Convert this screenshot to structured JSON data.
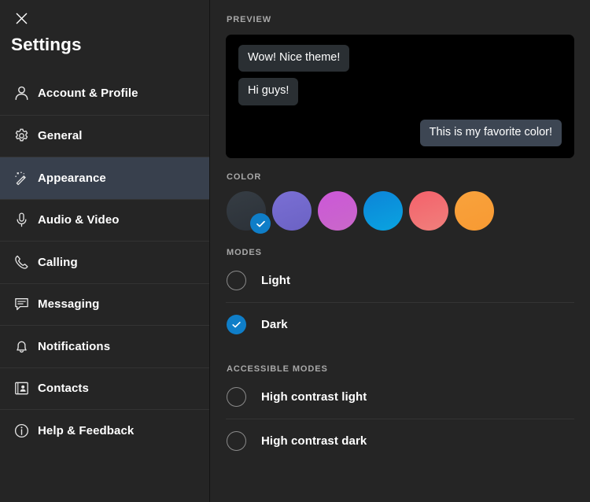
{
  "window": {
    "close_icon": "close-icon",
    "title": "Settings"
  },
  "sidebar": {
    "items": [
      {
        "label": "Account & Profile",
        "icon": "person-icon",
        "active": false
      },
      {
        "label": "General",
        "icon": "gear-icon",
        "active": false
      },
      {
        "label": "Appearance",
        "icon": "magic-wand-icon",
        "active": true
      },
      {
        "label": "Audio & Video",
        "icon": "microphone-icon",
        "active": false
      },
      {
        "label": "Calling",
        "icon": "phone-icon",
        "active": false
      },
      {
        "label": "Messaging",
        "icon": "chat-bubble-icon",
        "active": false
      },
      {
        "label": "Notifications",
        "icon": "bell-icon",
        "active": false
      },
      {
        "label": "Contacts",
        "icon": "contact-card-icon",
        "active": false
      },
      {
        "label": "Help & Feedback",
        "icon": "info-circle-icon",
        "active": false
      }
    ]
  },
  "main": {
    "preview": {
      "heading": "PREVIEW",
      "messages": [
        {
          "text": "Wow! Nice theme!",
          "direction": "incoming"
        },
        {
          "text": "Hi guys!",
          "direction": "incoming"
        },
        {
          "text": "This is my favorite color!",
          "direction": "outgoing"
        }
      ],
      "background": "#000000",
      "incoming_bubble_color": "#2a2f33",
      "outgoing_bubble_color": "#3d4653"
    },
    "color": {
      "heading": "COLOR",
      "selected_index": 0,
      "swatches": [
        {
          "name": "slate",
          "from": "#363d44",
          "to": "#2b3138",
          "selected": true
        },
        {
          "name": "periwinkle",
          "from": "#7a6fd4",
          "to": "#6b62c4",
          "selected": false
        },
        {
          "name": "orchid",
          "from": "#cc57d8",
          "to": "#c968c9",
          "selected": false
        },
        {
          "name": "azure",
          "from": "#0c84d8",
          "to": "#0aa4e0",
          "selected": false
        },
        {
          "name": "salmon",
          "from": "#f4616b",
          "to": "#f0807c",
          "selected": false
        },
        {
          "name": "orange",
          "from": "#f9a23c",
          "to": "#f79a33",
          "selected": false
        }
      ]
    },
    "modes": {
      "heading": "MODES",
      "options": [
        {
          "label": "Light",
          "selected": false
        },
        {
          "label": "Dark",
          "selected": true
        }
      ]
    },
    "accessible_modes": {
      "heading": "ACCESSIBLE MODES",
      "options": [
        {
          "label": "High contrast light",
          "selected": false
        },
        {
          "label": "High contrast dark",
          "selected": false
        }
      ]
    }
  },
  "colors": {
    "accent": "#0f7ec8",
    "sidebar_bg": "#252525",
    "active_item_bg": "#38404d",
    "section_heading": "#a8a8a8"
  }
}
